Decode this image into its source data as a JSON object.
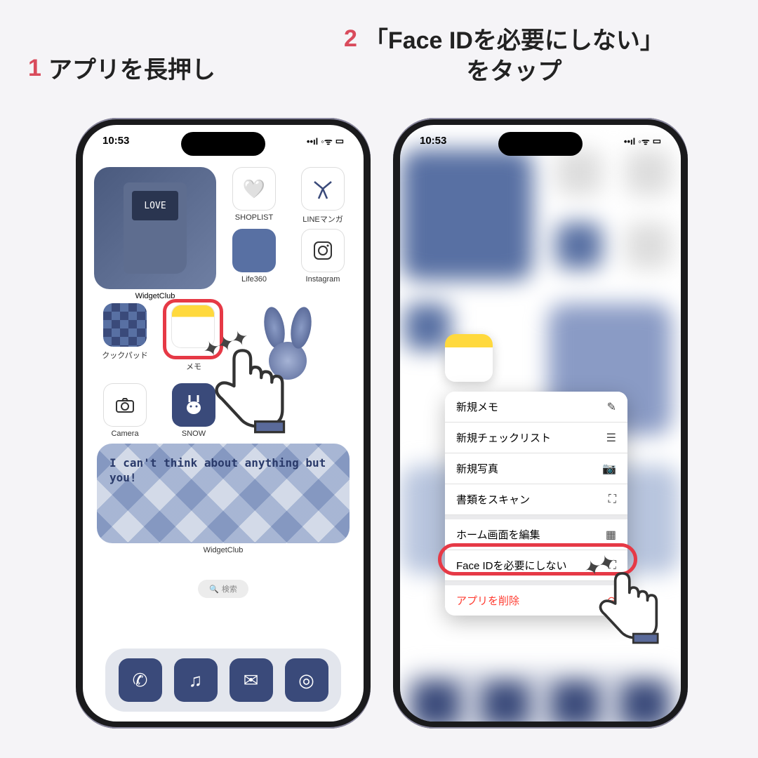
{
  "steps": {
    "s1": {
      "num": "1",
      "text": "アプリを長押し"
    },
    "s2": {
      "num": "2",
      "line1": "「Face IDを必要にしない」",
      "line2": "をタップ"
    }
  },
  "status": {
    "time": "10:53"
  },
  "apps": {
    "widgetclub": "WidgetClub",
    "shoplist": "SHOPLIST",
    "linemanga": "LINEマンガ",
    "life360": "Life360",
    "instagram": "Instagram",
    "cookpad": "クックパッド",
    "memo": "メモ",
    "camera": "Camera",
    "snow": "SNOW"
  },
  "quilt_text": "I can't think about anything but you!",
  "quilt_label": "WidgetClub",
  "search": "検索",
  "context_menu": {
    "new_memo": "新規メモ",
    "new_checklist": "新規チェックリスト",
    "new_photo": "新規写真",
    "scan_doc": "書類をスキャン",
    "edit_home": "ホーム画面を編集",
    "no_faceid": "Face IDを必要にしない",
    "delete_app": "アプリを削除"
  }
}
